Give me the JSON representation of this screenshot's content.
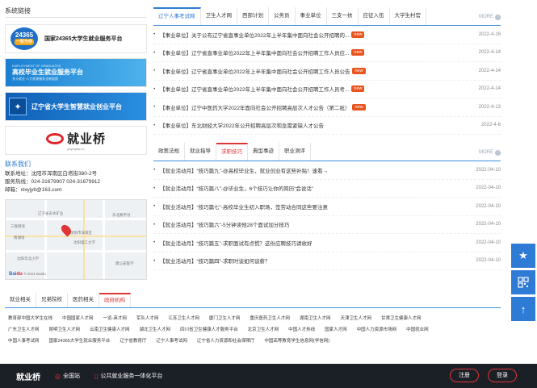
{
  "left": {
    "title": "系统链接",
    "banners": {
      "b1_logo": "24365",
      "b1_tag": "一职为你",
      "b1_text": "国家24365大学生就业服务平台",
      "b2_top": "EMPLOYMENT OF GRADUATES",
      "b2_main": "高校毕业生就业服务平台",
      "b2_sub": "多元就业 人力资源服务全新起航",
      "b3_main": "辽宁省大学生智慧就业创业平台",
      "b4_text": "就业桥",
      "b4_sub": "jiuyeqiao.cn"
    },
    "contact": {
      "title": "联系我们",
      "address": "联系地址：沈阳市浑南区白塔街380-2号",
      "phone": "服务热线：024-31679907 024-31679912",
      "email": "邮箱：xlxyjyb@163.com"
    },
    "map": {
      "labels": [
        "辽宁省去水矿业",
        "沈阳市浑南区",
        "沈阳理工大学",
        "三盘牌浪",
        "南湖坊",
        "沈阳华北小学",
        "东北数字谷",
        "建公安医学"
      ],
      "copyright": "© 2021 Baidu"
    }
  },
  "panel1": {
    "tabs": [
      "辽宁人事考试网",
      "卫生人才网",
      "西部计划",
      "公务员",
      "事业单位",
      "三支一扶",
      "应征入伍",
      "大学生村官"
    ],
    "more": "MORE",
    "items": [
      {
        "text": "【事业单位】关于公布辽宁省直事业单位2022年上半年集中面向社会公开招聘的...",
        "new": true,
        "date": "2022-4-16"
      },
      {
        "text": "【事业单位】辽宁省直事业单位2022年上半年集中面向社会公开招聘工作人员应...",
        "new": true,
        "date": "2022-4-14"
      },
      {
        "text": "【事业单位】辽宁省直事业单位2022年上半年集中面向社会公开招聘工作人员公告",
        "new": true,
        "date": "2022-4-14"
      },
      {
        "text": "【事业单位】辽宁省直事业单位2022年上半年集中面向社会公开招聘工作人员考...",
        "new": true,
        "date": "2022-4-14"
      },
      {
        "text": "【事业单位】辽宁中医药大学2022年面向社会公开招聘高层次人才公告（第二批）",
        "new": true,
        "date": "2022-4-13"
      },
      {
        "text": "【事业单位】东北财经大学2022年公开招聘高层次和急需紧缺人才公告",
        "new": false,
        "date": "2022-4-6"
      }
    ],
    "new_label": "new"
  },
  "panel2": {
    "tabs": [
      "政策法规",
      "就业指导",
      "求职技巧",
      "典型事迹",
      "职业测评"
    ],
    "more": "MORE",
    "items": [
      {
        "text": "【就业活动月】“技巧篇九”-@高校毕业生，就业创业有这些补贴！速看→",
        "date": "2022-04-10"
      },
      {
        "text": "【就业活动月】“技巧篇八”-@毕业生，6个技巧让你的简历“会说话”",
        "date": "2022-04-10"
      },
      {
        "text": "【就业活动月】“技巧篇七”-高校毕业生初入职场，签劳动合同这些要注意",
        "date": "2022-04-10"
      },
      {
        "text": "【就业活动月】“技巧篇六”-5分钟读他28个面试加分技巧",
        "date": "2022-04-10"
      },
      {
        "text": "【就业活动月】“技巧篇五”-求职面试有点慌？这份应聘技巧请收好",
        "date": "2022-04-10"
      },
      {
        "text": "【就业活动月】“技巧篇四”-求职时谈如何谈薪？",
        "date": "2022-04-10"
      }
    ]
  },
  "links": {
    "tabs": [
      "就业相关",
      "兄弟院校",
      "医药相关",
      "政府机构"
    ],
    "row1": [
      "教育部中国大学生在线",
      "中国国家人才网",
      "一览-英才网",
      "军队人才网",
      "江苏卫生人才网",
      "厦门卫生人才网",
      "重庆医药卫生人才网",
      "湖南卫生人才网",
      "天津卫生人才网",
      "甘肃卫生健康人才网"
    ],
    "row2": [
      "广东卫生人才网",
      "昆明卫生人才网",
      "云南卫生健康人才网",
      "湖北卫生人才网",
      "四川省卫生健康人才服务平台",
      "北京卫生人才网",
      "中国人才热线",
      "国家人才网",
      "中国人力资源市场网",
      "中国就业网"
    ],
    "row3": [
      "中国人事考试网",
      "国家24365大学生就业服务平台",
      "辽宁省教育厅",
      "辽宁人事考试网",
      "辽宁省人力资源和社会保障厅",
      "中国高等教育学生信息网(学信网)"
    ]
  },
  "sidebuttons": [
    "star-icon",
    "qrcode-icon",
    "arrow-up-icon"
  ],
  "footer": {
    "brand": "就业桥",
    "site": "全国站",
    "platform": "公共就业服务一体化平台",
    "register": "注册",
    "login": "登录"
  },
  "colors": {
    "accent": "#2e7bd6",
    "highlight": "#e03535",
    "footer_bg": "#1b1f26",
    "new_badge": "#e8541e"
  }
}
